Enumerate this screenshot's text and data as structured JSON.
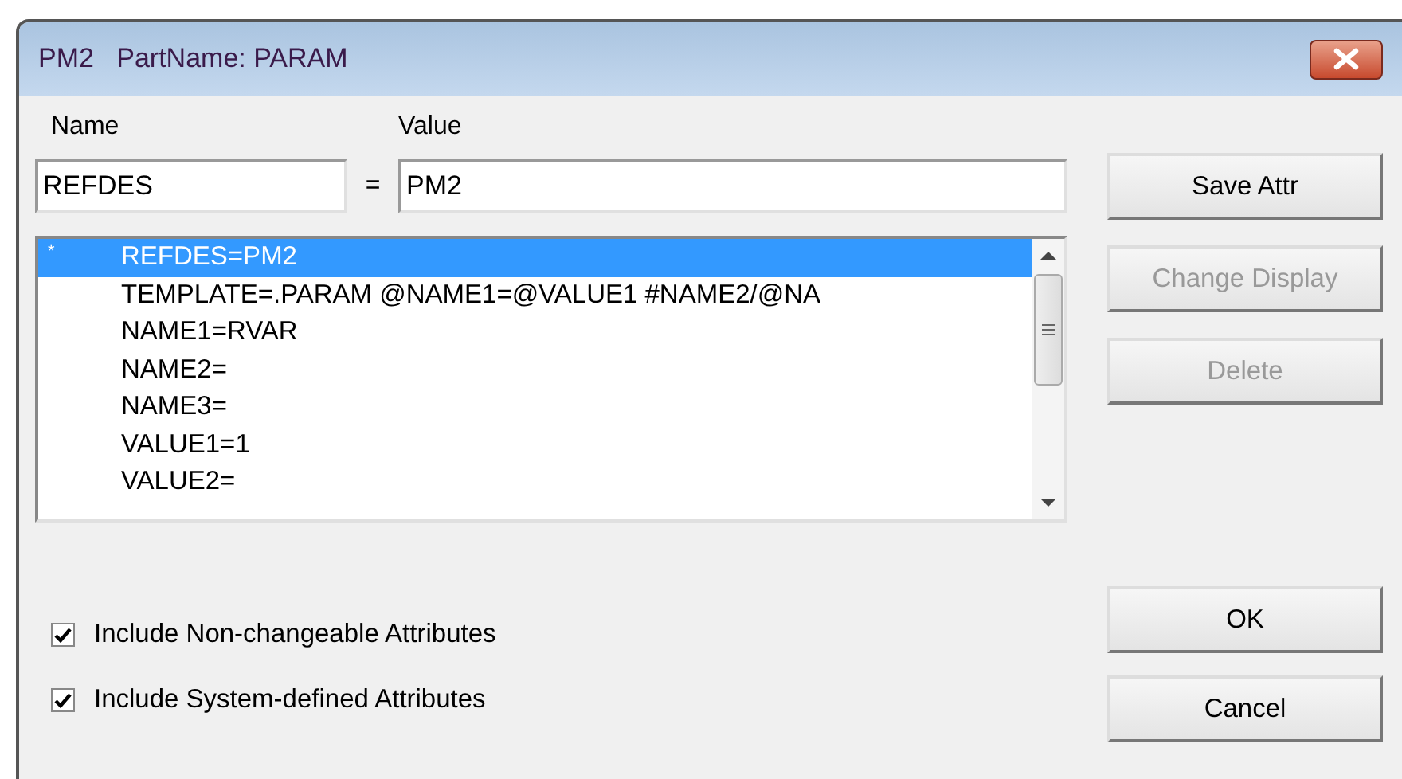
{
  "window": {
    "title": "PM2   PartName: PARAM"
  },
  "name_field": {
    "label": "Name",
    "value": "REFDES"
  },
  "equals": "=",
  "value_field": {
    "label": "Value",
    "value": "PM2"
  },
  "attributes": [
    {
      "marker": "*",
      "text": "REFDES=PM2",
      "selected": true
    },
    {
      "text": "TEMPLATE=.PARAM @NAME1=@VALUE1 #NAME2/@NA",
      "selected": false
    },
    {
      "text": "NAME1=RVAR",
      "selected": false
    },
    {
      "text": "NAME2=",
      "selected": false
    },
    {
      "text": "NAME3=",
      "selected": false
    },
    {
      "text": "VALUE1=1",
      "selected": false
    },
    {
      "text": "VALUE2=",
      "selected": false
    }
  ],
  "side_buttons": [
    {
      "label": "Save Attr",
      "disabled": false
    },
    {
      "label": "Change Display",
      "disabled": true
    },
    {
      "label": "Delete",
      "disabled": true
    }
  ],
  "options": [
    {
      "label": "Include Non-changeable Attributes",
      "checked": true
    },
    {
      "label": "Include System-defined Attributes",
      "checked": true
    }
  ],
  "dialog_buttons": [
    {
      "label": "OK",
      "disabled": false
    },
    {
      "label": "Cancel",
      "disabled": false
    }
  ]
}
